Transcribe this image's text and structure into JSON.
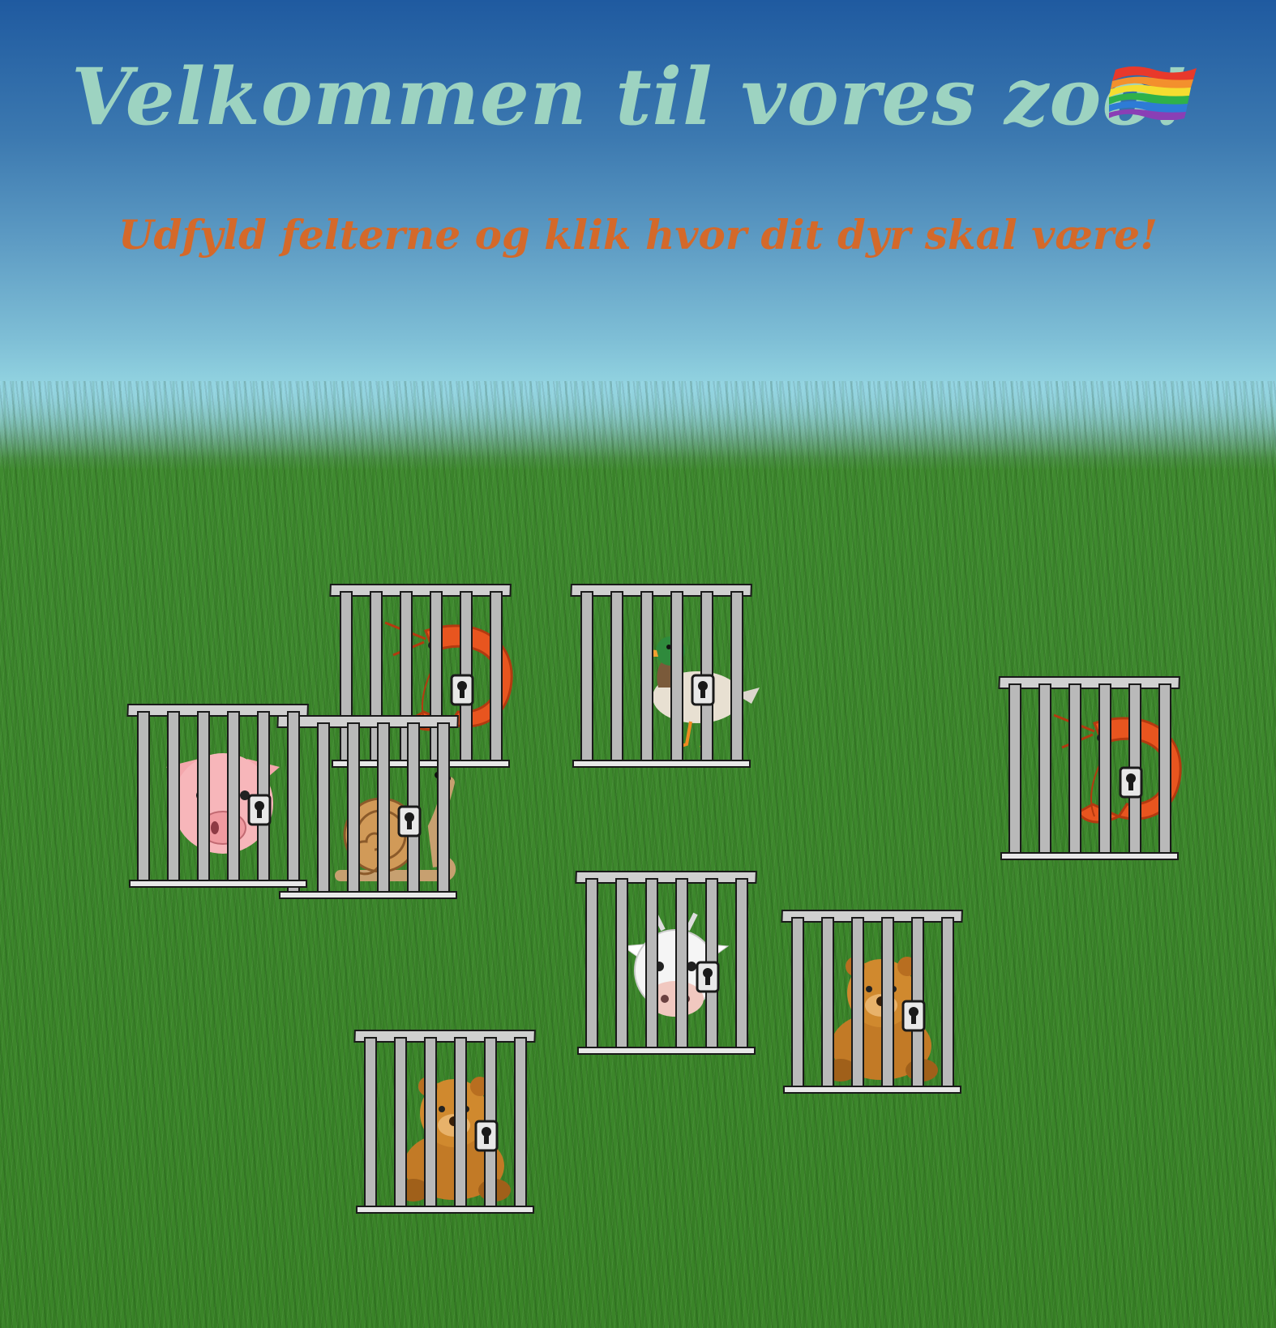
{
  "header": {
    "title": "Velkommen til vores zoo!",
    "flag_icon": "rainbow-flag-icon",
    "subtitle": "Udfyld felterne og klik hvor dit dyr skal være!"
  },
  "colors": {
    "title": "#9dd3c1",
    "subtitle": "#d4692a",
    "sky_top": "#1f5aa0",
    "sky_bottom": "#93d4e1",
    "grass": "#3a8428",
    "cage_bar": "#b9b9b9"
  },
  "zoo": {
    "cages": [
      {
        "animal": "shrimp-icon"
      },
      {
        "animal": "duck-icon"
      },
      {
        "animal": "snail-icon"
      },
      {
        "animal": "pig-icon"
      },
      {
        "animal": "shrimp-icon"
      },
      {
        "animal": "cow-icon"
      },
      {
        "animal": "bear-icon"
      },
      {
        "animal": "bear-icon"
      }
    ]
  }
}
